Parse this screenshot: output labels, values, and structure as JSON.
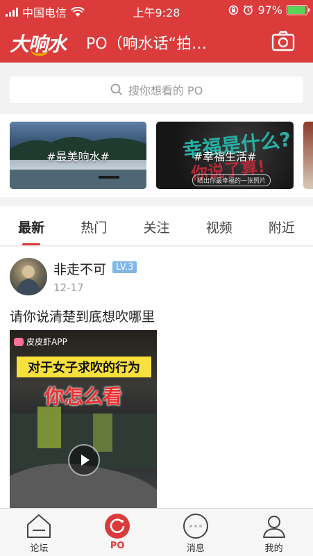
{
  "status_bar": {
    "carrier": "中国电信",
    "time": "上午9:28",
    "battery": "97%"
  },
  "header": {
    "logo": "大响水",
    "title": "PO（响水话“拍…"
  },
  "search": {
    "placeholder": "搜你想看的 PO"
  },
  "banners": [
    {
      "tag": "#最美响水#"
    },
    {
      "tag": "#幸福生活#",
      "overlay_1": "幸福是什么?",
      "overlay_2": "你说了算!",
      "pill": "晒出你最幸福的一张照片"
    }
  ],
  "tabs": [
    "最新",
    "热门",
    "关注",
    "视频",
    "附近"
  ],
  "active_tab": "最新",
  "post": {
    "username": "非走不可",
    "level": "LV.3",
    "date": "12-17",
    "text": "请你说清楚到底想吹哪里",
    "video": {
      "watermark": "皮皮虾APP",
      "caption_1": "对于女子求吹的行为",
      "caption_2": "你怎么看"
    }
  },
  "tabbar": [
    {
      "label": "论坛",
      "icon": "forum-icon"
    },
    {
      "label": "PO",
      "icon": "po-icon"
    },
    {
      "label": "消息",
      "icon": "message-icon"
    },
    {
      "label": "我的",
      "icon": "profile-icon"
    }
  ],
  "colors": {
    "brand_red": "#db3b3a",
    "level_blue": "#7fb6ea",
    "battery_green": "#5ad35a"
  }
}
